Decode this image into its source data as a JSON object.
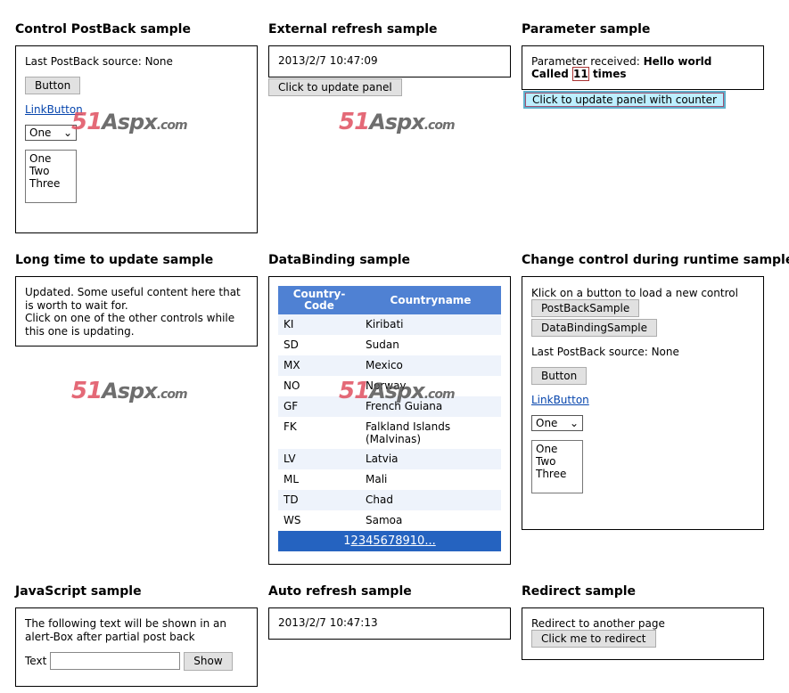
{
  "control_postback": {
    "title": "Control PostBack sample",
    "source_text": "Last PostBack source: None",
    "button": "Button",
    "link": "LinkButton",
    "select_value": "One",
    "list": [
      "One",
      "Two",
      "Three"
    ]
  },
  "external_refresh": {
    "title": "External refresh sample",
    "time": "2013/2/7 10:47:09",
    "button": "Click to update panel"
  },
  "parameter": {
    "title": "Parameter sample",
    "received_label": "Parameter received:",
    "received_value": "Hello world",
    "called_prefix": "Called",
    "count": "11",
    "called_suffix": "times",
    "button": "Click to update panel with counter"
  },
  "long_time": {
    "title": "Long time to update sample",
    "text1": "Updated. Some useful content here that is worth to wait for.",
    "text2": "Click on one of the other controls while this one is updating."
  },
  "databinding": {
    "title": "DataBinding sample",
    "headers": [
      "Country-Code",
      "Countryname"
    ],
    "rows": [
      [
        "KI",
        "Kiribati"
      ],
      [
        "SD",
        "Sudan"
      ],
      [
        "MX",
        "Mexico"
      ],
      [
        "NO",
        "Norway"
      ],
      [
        "GF",
        "French Guiana"
      ],
      [
        "FK",
        "Falkland Islands (Malvinas)"
      ],
      [
        "LV",
        "Latvia"
      ],
      [
        "ML",
        "Mali"
      ],
      [
        "TD",
        "Chad"
      ],
      [
        "WS",
        "Samoa"
      ]
    ],
    "pages": [
      "1",
      "2",
      "3",
      "4",
      "5",
      "6",
      "7",
      "8",
      "9",
      "10",
      "..."
    ],
    "current_page": "1"
  },
  "change_control": {
    "title": "Change control during runtime sample",
    "intro": "Klick on a button to load a new control",
    "btn1": "PostBackSample",
    "btn2": "DataBindingSample",
    "source_text": "Last PostBack source: None",
    "button": "Button",
    "link": "LinkButton",
    "select_value": "One",
    "list": [
      "One",
      "Two",
      "Three"
    ]
  },
  "javascript": {
    "title": "JavaScript sample",
    "text": "The following text will be shown in an alert-Box after partial post back",
    "label": "Text",
    "input_value": "",
    "button": "Show"
  },
  "auto_refresh": {
    "title": "Auto refresh sample",
    "time": "2013/2/7 10:47:13"
  },
  "redirect": {
    "title": "Redirect sample",
    "text": "Redirect to another page",
    "button": "Click me to redirect"
  },
  "watermark": "51Aspx.com"
}
